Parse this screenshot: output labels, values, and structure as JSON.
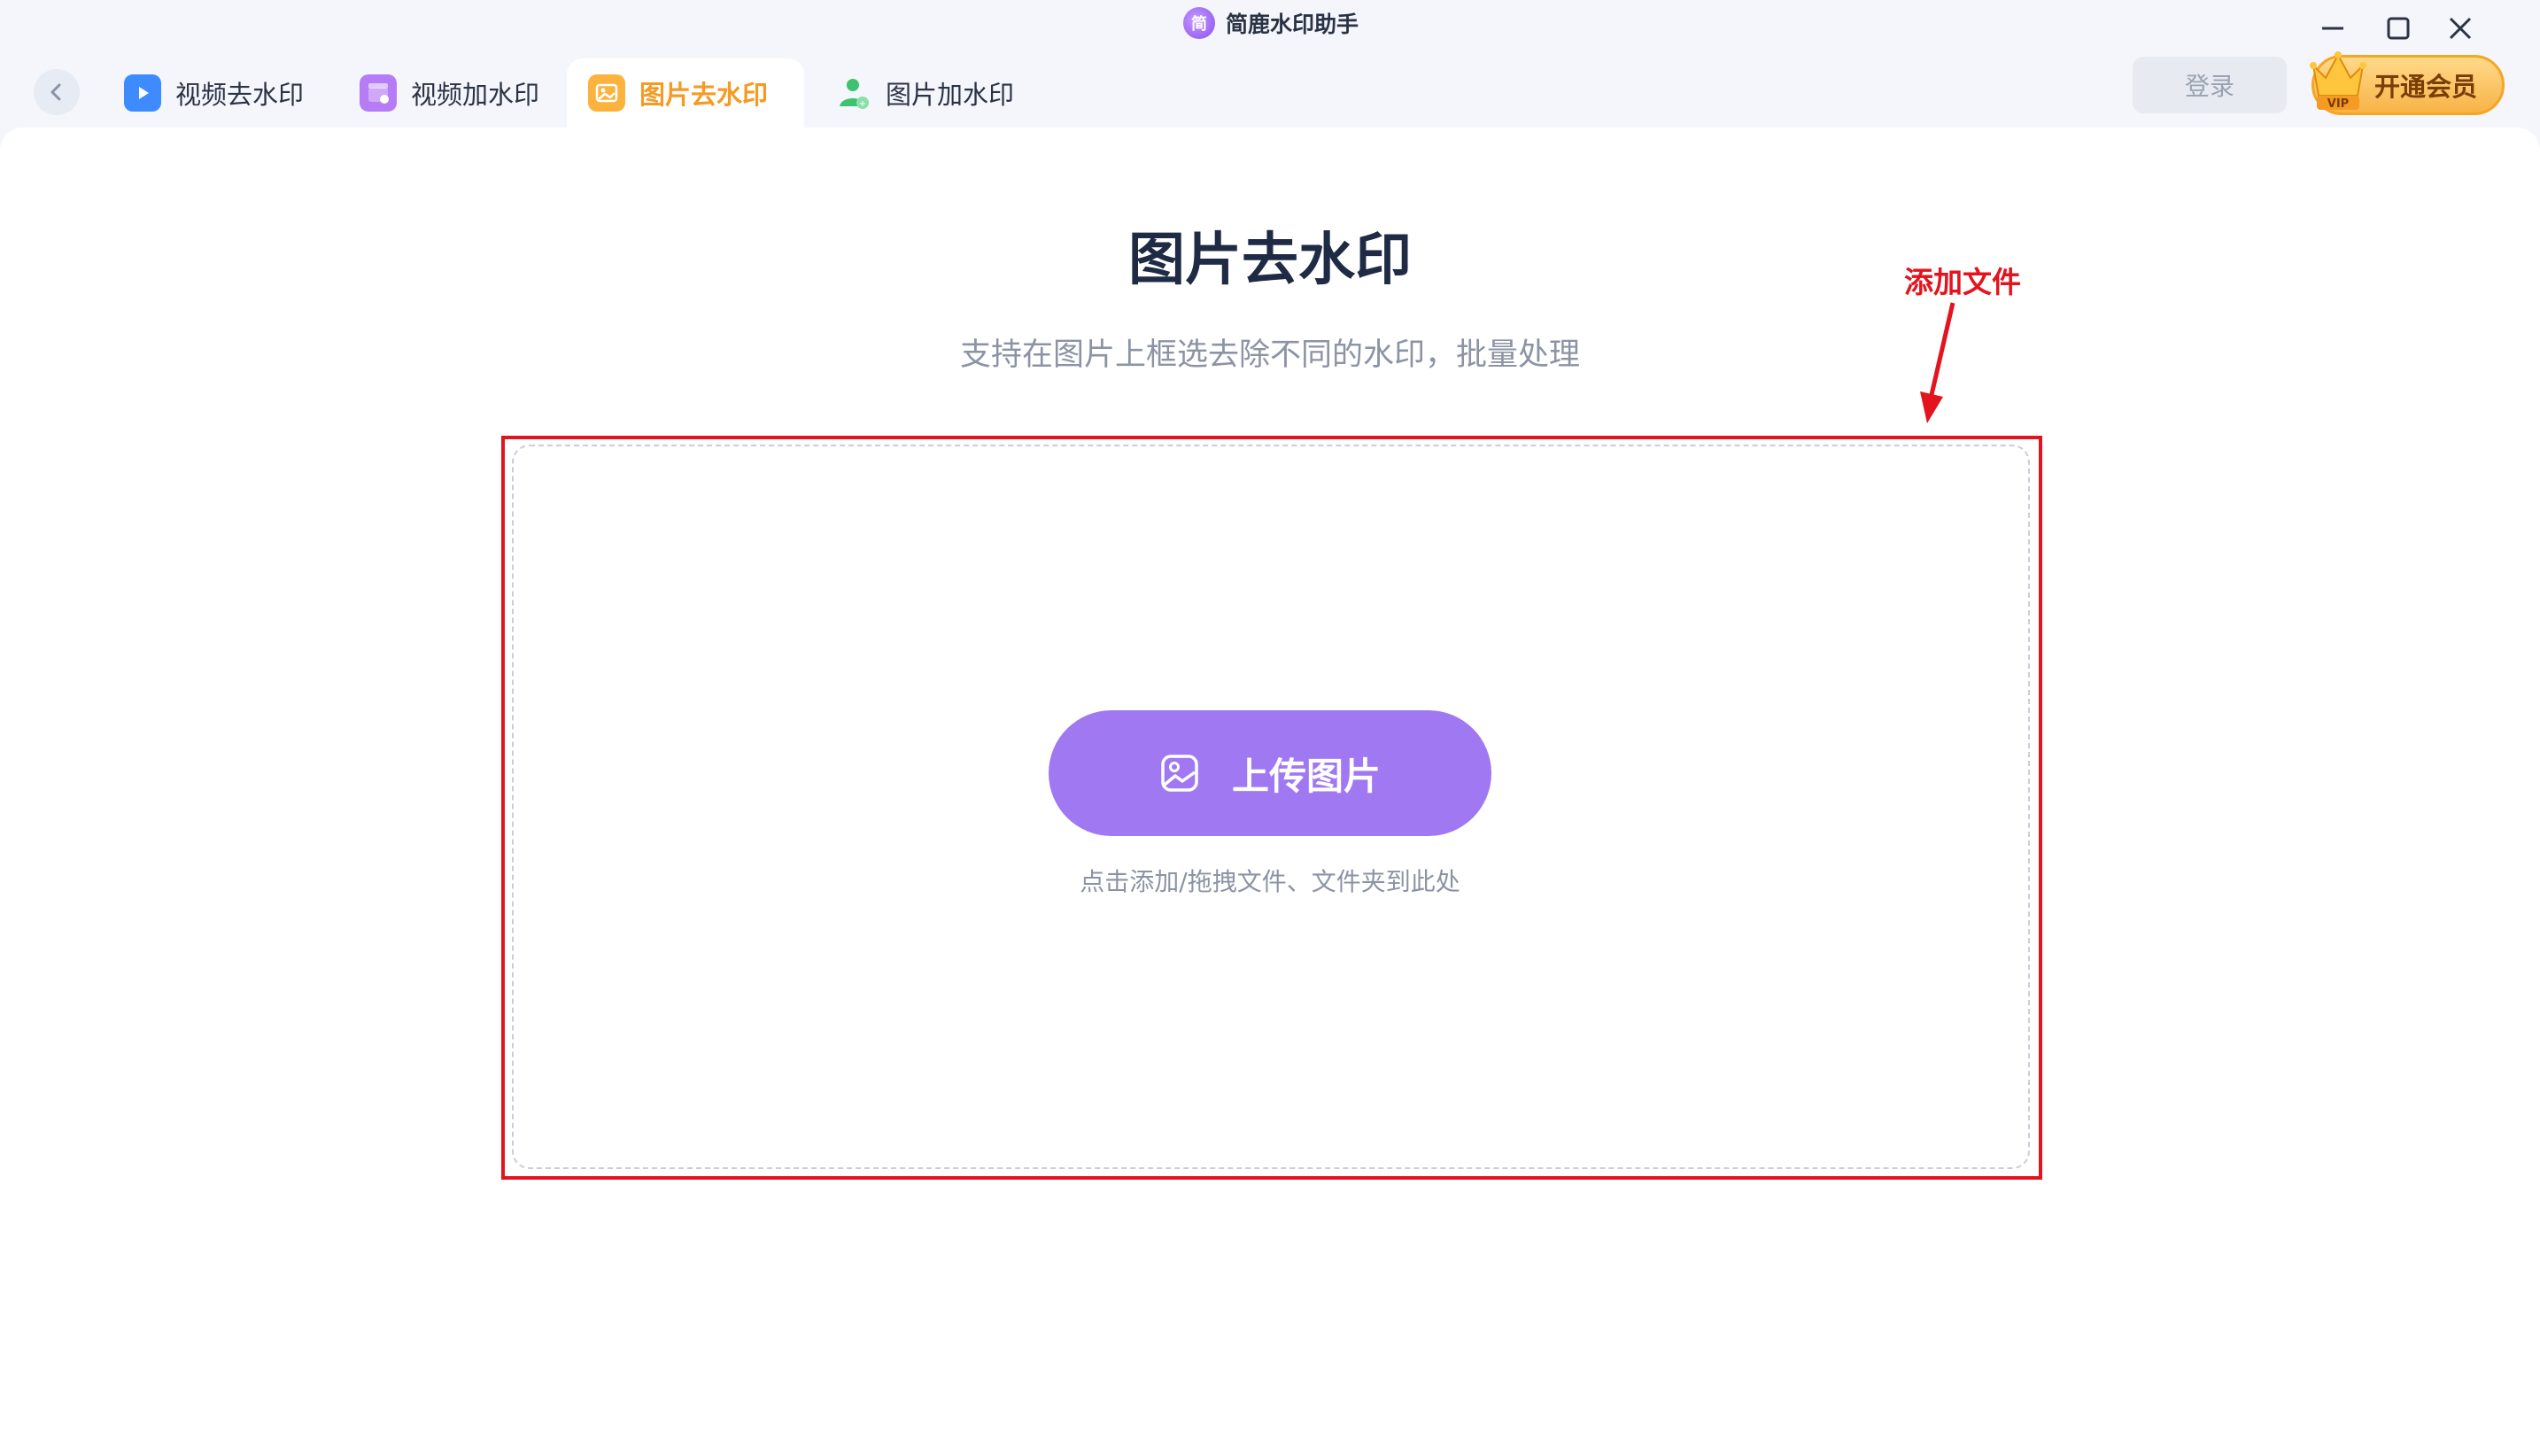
{
  "app": {
    "title": "简鹿水印助手"
  },
  "tabs": [
    {
      "label": "视频去水印",
      "icon": "video-remove-watermark-icon",
      "active": false
    },
    {
      "label": "视频加水印",
      "icon": "video-add-watermark-icon",
      "active": false
    },
    {
      "label": "图片去水印",
      "icon": "image-remove-watermark-icon",
      "active": true
    },
    {
      "label": "图片加水印",
      "icon": "image-add-watermark-icon",
      "active": false
    }
  ],
  "header": {
    "login_label": "登录",
    "vip_label": "开通会员",
    "vip_badge": "VIP"
  },
  "main": {
    "title": "图片去水印",
    "subtitle": "支持在图片上框选去除不同的水印，批量处理",
    "upload_button_label": "上传图片",
    "upload_hint": "点击添加/拖拽文件、文件夹到此处"
  },
  "annotation": {
    "label": "添加文件",
    "color": "#e3141e"
  },
  "colors": {
    "accent": "#a078f2",
    "active_tab": "#f59a23",
    "vip": "#f7b446"
  }
}
